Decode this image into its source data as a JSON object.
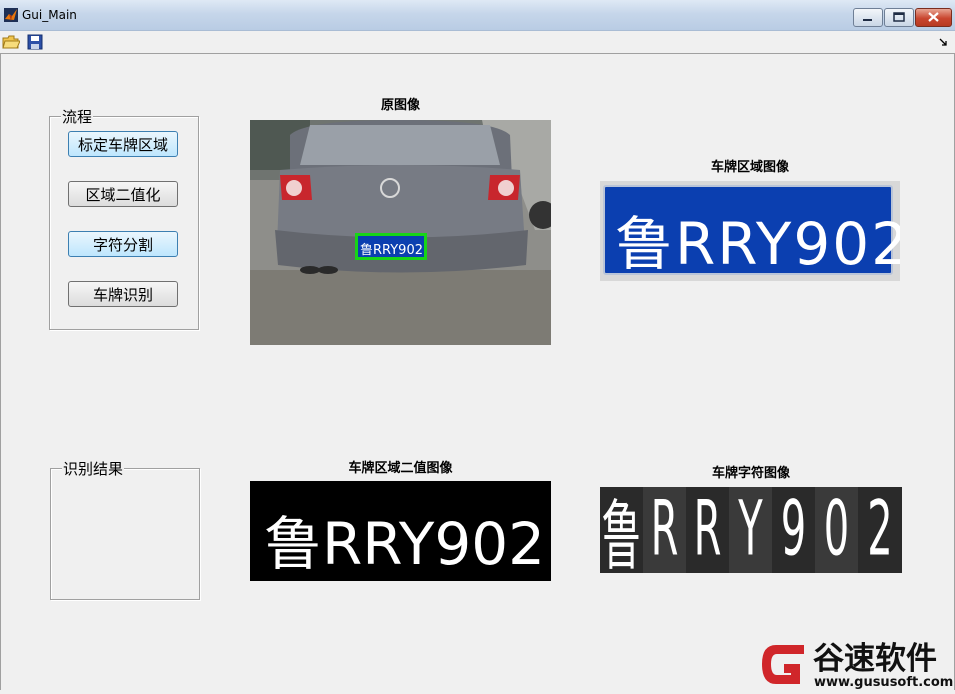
{
  "window": {
    "title": "Gui_Main",
    "controls": {
      "minimize_icon": "minimize-icon",
      "maximize_icon": "maximize-icon",
      "close_icon": "close-icon"
    }
  },
  "toolbar": {
    "items": [
      {
        "icon": "open-folder-icon"
      },
      {
        "icon": "save-icon"
      }
    ],
    "dock_icon": "dock-arrow-icon"
  },
  "process_panel": {
    "title": "流程",
    "buttons": [
      "标定车牌区域",
      "区域二值化",
      "字符分割",
      "车牌识别"
    ]
  },
  "result_panel": {
    "title": "识别结果",
    "text": ""
  },
  "axes": {
    "original": {
      "title": "原图像",
      "plate_text": "鲁RRY902"
    },
    "plate_region": {
      "title": "车牌区域图像",
      "plate_text": "鲁RRY902"
    },
    "binary": {
      "title": "车牌区域二值图像",
      "plate_text": "鲁RRY902"
    },
    "characters": {
      "title": "车牌字符图像",
      "chars": [
        "鲁",
        "R",
        "R",
        "Y",
        "9",
        "0",
        "2"
      ]
    }
  },
  "watermark": {
    "brand": "谷速软件",
    "url": "www.gususoft.com",
    "color": "#d0262a"
  },
  "colors": {
    "plate_blue": "#0b3fb0",
    "detect_box": "#18d418"
  }
}
